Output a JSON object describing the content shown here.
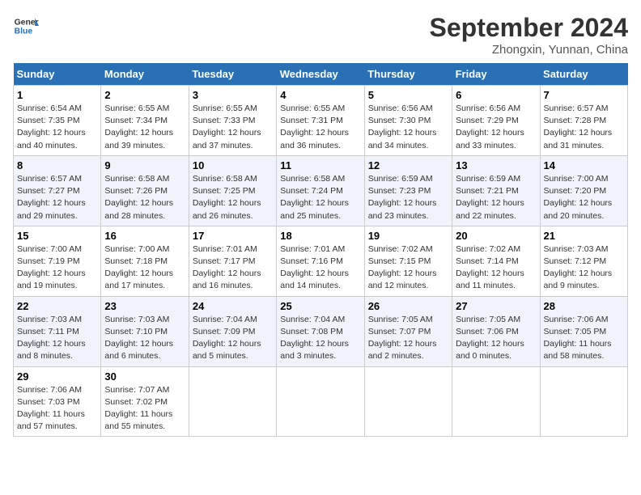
{
  "header": {
    "logo_line1": "General",
    "logo_line2": "Blue",
    "month": "September 2024",
    "location": "Zhongxin, Yunnan, China"
  },
  "days_of_week": [
    "Sunday",
    "Monday",
    "Tuesday",
    "Wednesday",
    "Thursday",
    "Friday",
    "Saturday"
  ],
  "weeks": [
    [
      {
        "day": "1",
        "sunrise": "6:54 AM",
        "sunset": "7:35 PM",
        "daylight": "12 hours and 40 minutes."
      },
      {
        "day": "2",
        "sunrise": "6:55 AM",
        "sunset": "7:34 PM",
        "daylight": "12 hours and 39 minutes."
      },
      {
        "day": "3",
        "sunrise": "6:55 AM",
        "sunset": "7:33 PM",
        "daylight": "12 hours and 37 minutes."
      },
      {
        "day": "4",
        "sunrise": "6:55 AM",
        "sunset": "7:31 PM",
        "daylight": "12 hours and 36 minutes."
      },
      {
        "day": "5",
        "sunrise": "6:56 AM",
        "sunset": "7:30 PM",
        "daylight": "12 hours and 34 minutes."
      },
      {
        "day": "6",
        "sunrise": "6:56 AM",
        "sunset": "7:29 PM",
        "daylight": "12 hours and 33 minutes."
      },
      {
        "day": "7",
        "sunrise": "6:57 AM",
        "sunset": "7:28 PM",
        "daylight": "12 hours and 31 minutes."
      }
    ],
    [
      {
        "day": "8",
        "sunrise": "6:57 AM",
        "sunset": "7:27 PM",
        "daylight": "12 hours and 29 minutes."
      },
      {
        "day": "9",
        "sunrise": "6:58 AM",
        "sunset": "7:26 PM",
        "daylight": "12 hours and 28 minutes."
      },
      {
        "day": "10",
        "sunrise": "6:58 AM",
        "sunset": "7:25 PM",
        "daylight": "12 hours and 26 minutes."
      },
      {
        "day": "11",
        "sunrise": "6:58 AM",
        "sunset": "7:24 PM",
        "daylight": "12 hours and 25 minutes."
      },
      {
        "day": "12",
        "sunrise": "6:59 AM",
        "sunset": "7:23 PM",
        "daylight": "12 hours and 23 minutes."
      },
      {
        "day": "13",
        "sunrise": "6:59 AM",
        "sunset": "7:21 PM",
        "daylight": "12 hours and 22 minutes."
      },
      {
        "day": "14",
        "sunrise": "7:00 AM",
        "sunset": "7:20 PM",
        "daylight": "12 hours and 20 minutes."
      }
    ],
    [
      {
        "day": "15",
        "sunrise": "7:00 AM",
        "sunset": "7:19 PM",
        "daylight": "12 hours and 19 minutes."
      },
      {
        "day": "16",
        "sunrise": "7:00 AM",
        "sunset": "7:18 PM",
        "daylight": "12 hours and 17 minutes."
      },
      {
        "day": "17",
        "sunrise": "7:01 AM",
        "sunset": "7:17 PM",
        "daylight": "12 hours and 16 minutes."
      },
      {
        "day": "18",
        "sunrise": "7:01 AM",
        "sunset": "7:16 PM",
        "daylight": "12 hours and 14 minutes."
      },
      {
        "day": "19",
        "sunrise": "7:02 AM",
        "sunset": "7:15 PM",
        "daylight": "12 hours and 12 minutes."
      },
      {
        "day": "20",
        "sunrise": "7:02 AM",
        "sunset": "7:14 PM",
        "daylight": "12 hours and 11 minutes."
      },
      {
        "day": "21",
        "sunrise": "7:03 AM",
        "sunset": "7:12 PM",
        "daylight": "12 hours and 9 minutes."
      }
    ],
    [
      {
        "day": "22",
        "sunrise": "7:03 AM",
        "sunset": "7:11 PM",
        "daylight": "12 hours and 8 minutes."
      },
      {
        "day": "23",
        "sunrise": "7:03 AM",
        "sunset": "7:10 PM",
        "daylight": "12 hours and 6 minutes."
      },
      {
        "day": "24",
        "sunrise": "7:04 AM",
        "sunset": "7:09 PM",
        "daylight": "12 hours and 5 minutes."
      },
      {
        "day": "25",
        "sunrise": "7:04 AM",
        "sunset": "7:08 PM",
        "daylight": "12 hours and 3 minutes."
      },
      {
        "day": "26",
        "sunrise": "7:05 AM",
        "sunset": "7:07 PM",
        "daylight": "12 hours and 2 minutes."
      },
      {
        "day": "27",
        "sunrise": "7:05 AM",
        "sunset": "7:06 PM",
        "daylight": "12 hours and 0 minutes."
      },
      {
        "day": "28",
        "sunrise": "7:06 AM",
        "sunset": "7:05 PM",
        "daylight": "11 hours and 58 minutes."
      }
    ],
    [
      {
        "day": "29",
        "sunrise": "7:06 AM",
        "sunset": "7:03 PM",
        "daylight": "11 hours and 57 minutes."
      },
      {
        "day": "30",
        "sunrise": "7:07 AM",
        "sunset": "7:02 PM",
        "daylight": "11 hours and 55 minutes."
      },
      null,
      null,
      null,
      null,
      null
    ]
  ]
}
